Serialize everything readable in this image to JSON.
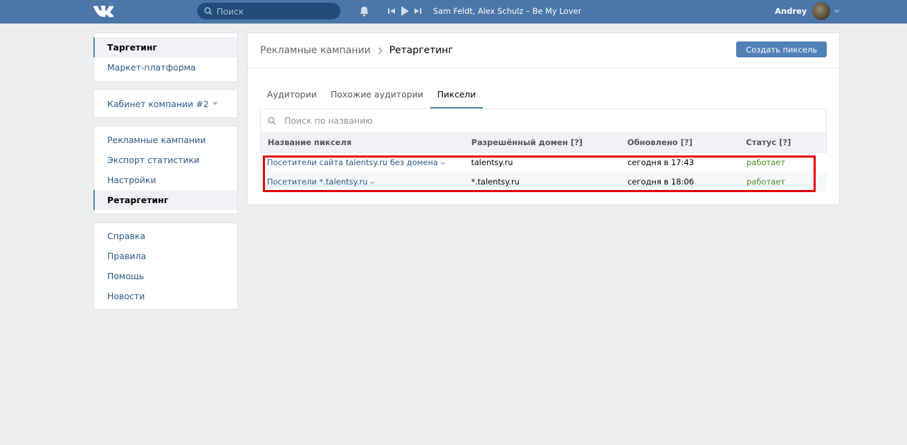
{
  "colors": {
    "header_bg": "#4a76a8",
    "accent": "#5181b8",
    "link": "#2a5885",
    "status_ok": "#4a8c23",
    "highlight_box": "#e00000"
  },
  "header": {
    "search_placeholder": "Поиск",
    "track": "Sam Feldt, Alex Schulz – Be My Lover",
    "user_name": "Andrey",
    "icons": [
      "vk-logo",
      "search-icon",
      "bell-icon",
      "prev-track-icon",
      "play-icon",
      "next-track-icon",
      "chevron-down-icon"
    ]
  },
  "sidebar": {
    "group1": [
      {
        "label": "Таргетинг",
        "active": true
      },
      {
        "label": "Маркет-платформа",
        "active": false
      }
    ],
    "cabinet": "Кабинет компании #2",
    "group2": [
      {
        "label": "Рекламные кампании",
        "active": false
      },
      {
        "label": "Экспорт статистики",
        "active": false
      },
      {
        "label": "Настройки",
        "active": false
      },
      {
        "label": "Ретаргетинг",
        "active": true
      }
    ],
    "group3": [
      {
        "label": "Справка"
      },
      {
        "label": "Правила"
      },
      {
        "label": "Помощь"
      },
      {
        "label": "Новости"
      }
    ]
  },
  "main": {
    "breadcrumb": {
      "parent": "Рекламные кампании",
      "current": "Ретаргетинг"
    },
    "create_button": "Создать пиксель",
    "tabs": [
      {
        "label": "Аудитории",
        "active": false
      },
      {
        "label": "Похожие аудитории",
        "active": false
      },
      {
        "label": "Пиксели",
        "active": true
      }
    ],
    "search_placeholder": "Поиск по названию",
    "table": {
      "headers": [
        "Название пикселя",
        "Разрешённый домен [?]",
        "Обновлено [?]",
        "Статус [?]"
      ],
      "rows": [
        {
          "name": "Посетители сайта talentsy.ru без домена",
          "domain": "talentsy.ru",
          "updated": "сегодня в 17:43",
          "status": "работает"
        },
        {
          "name": "Посетители *.talentsy.ru",
          "domain": "*.talentsy.ru",
          "updated": "сегодня в 18:06",
          "status": "работает"
        }
      ]
    }
  }
}
